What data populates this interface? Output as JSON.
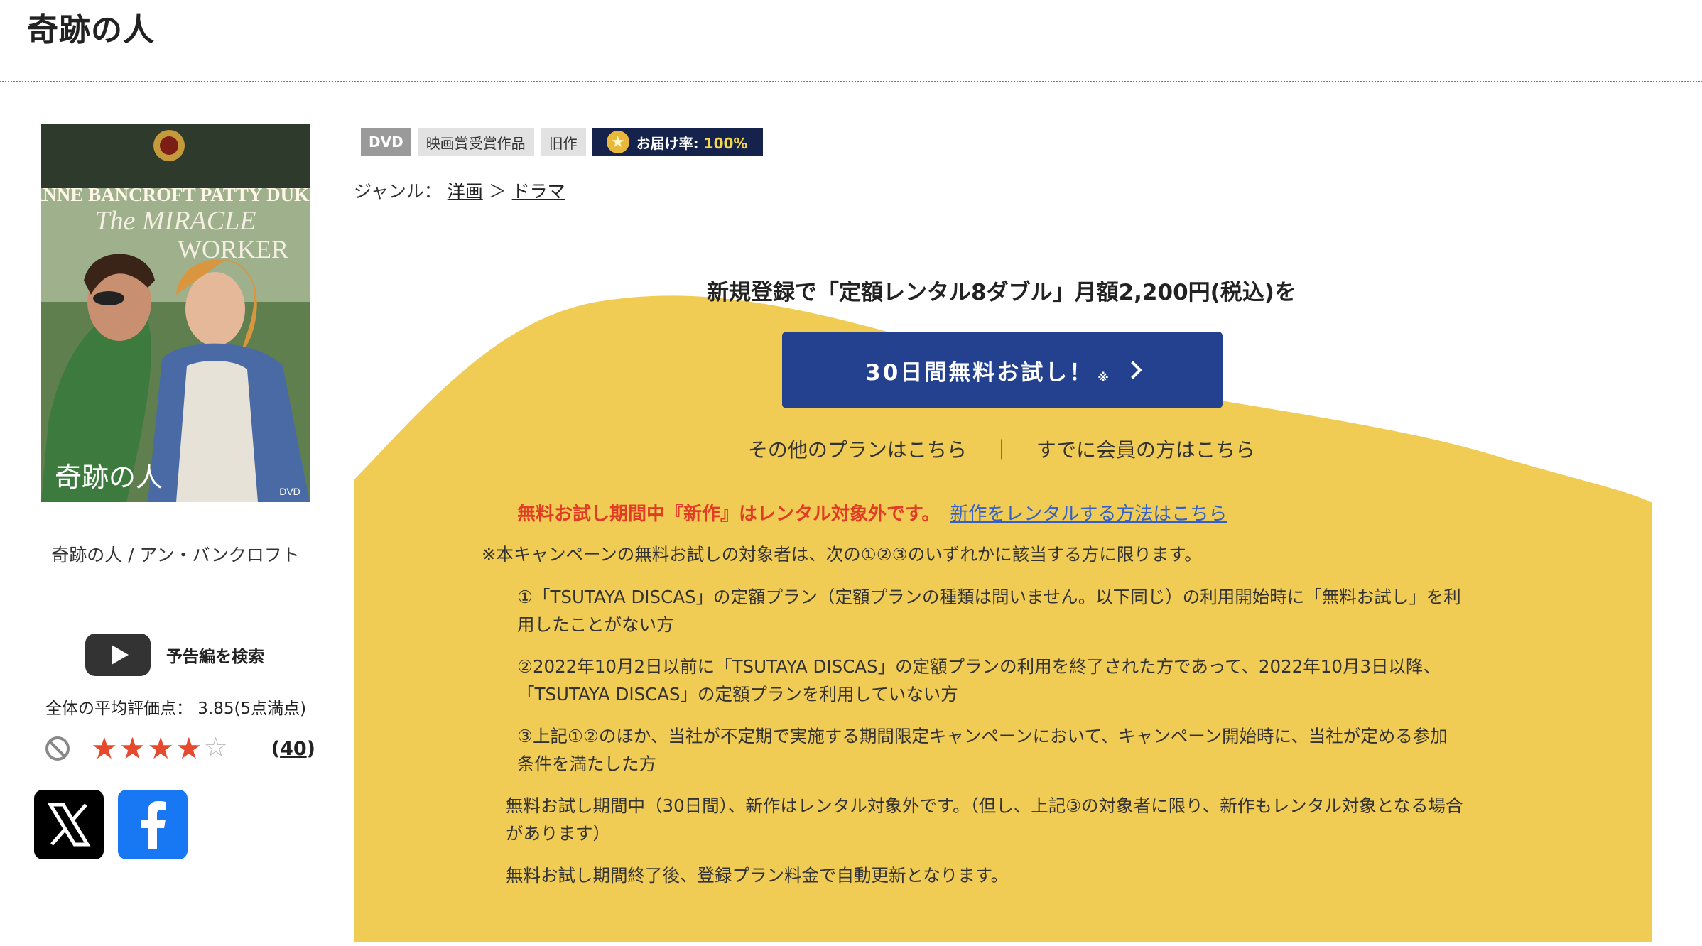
{
  "title": "奇跡の人",
  "cover": {
    "top_credits": "ANNE BANCROFT   PATTY DUKE",
    "title_line1": "The MIRACLE",
    "title_line2": "WORKER",
    "jp_title": "奇跡の人",
    "dvd_mark": "DVD"
  },
  "caption": "奇跡の人 / アン・バンクロフト",
  "trailer_label": "予告編を検索",
  "rating": {
    "average_text": "全体の平均評価点：  3.85(5点満点)",
    "value": 3.85,
    "max": 5,
    "filled_stars": 4,
    "count": "40",
    "count_prefix": "(",
    "count_suffix": ")"
  },
  "badges": {
    "dvd": "DVD",
    "award": "映画賞受賞作品",
    "old": "旧作",
    "delivery_label": "お届け率: ",
    "delivery_rate": "100%"
  },
  "genre": {
    "label": "ジャンル：",
    "level1": "洋画",
    "sep": "＞",
    "level2": "ドラマ"
  },
  "promo": {
    "headline": "新規登録で「定額レンタル8ダブル」月額2,200円(税込)を",
    "cta_label": "30日間無料お試し！",
    "cta_note": "※",
    "other_plans": "その他のプランはこちら",
    "divider": "｜",
    "members": "すでに会員の方はこちら",
    "warning": "無料お試し期間中『新作』はレンタル対象外です。",
    "warning_link": "新作をレンタルする方法はこちら",
    "notes": [
      "※本キャンペーンの無料お試しの対象者は、次の①②③のいずれかに該当する方に限ります。",
      "①「TSUTAYA DISCAS」の定額プラン（定額プランの種類は問いません。以下同じ）の利用開始時に「無料お試し」を利",
      "用したことがない方",
      "②2022年10月2日以前に「TSUTAYA DISCAS」の定額プランの利用を終了された方であって、2022年10月3日以降、",
      "「TSUTAYA DISCAS」の定額プランを利用していない方",
      "③上記①②のほか、当社が不定期で実施する期間限定キャンペーンにおいて、キャンペーン開始時に、当社が定める参加",
      "条件を満たした方",
      "無料お試し期間中（30日間）、新作はレンタル対象外です。（但し、上記③の対象者に限り、新作もレンタル対象となる場合",
      "があります）",
      "無料お試し期間終了後、登録プラン料金で自動更新となります。"
    ]
  },
  "colors": {
    "promo_yellow": "#f1cc54",
    "cta_blue": "#23418f",
    "delivery_navy": "#15234c",
    "warning_red": "#e23b26",
    "link_blue": "#3560c6",
    "star_red": "#e64a2e"
  },
  "icons": [
    "youtube-play-icon",
    "no-entry-icon",
    "star-icon",
    "x-logo-icon",
    "facebook-logo-icon",
    "chevron-right-icon",
    "coin-star-icon"
  ]
}
